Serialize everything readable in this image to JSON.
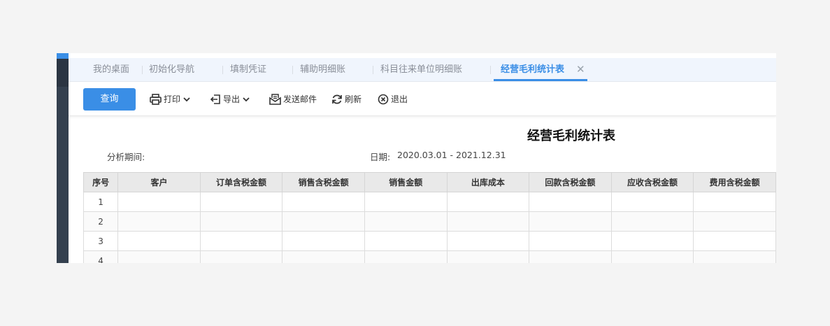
{
  "tabs": [
    {
      "label": "我的桌面",
      "active": false
    },
    {
      "label": "初始化导航",
      "active": false
    },
    {
      "label": "填制凭证",
      "active": false
    },
    {
      "label": "辅助明细账",
      "active": false
    },
    {
      "label": "科目往来单位明细账",
      "active": false
    },
    {
      "label": "经营毛利统计表",
      "active": true
    }
  ],
  "toolbar": {
    "query_label": "查询",
    "print_label": "打印",
    "export_label": "导出",
    "send_mail_label": "发送邮件",
    "refresh_label": "刷新",
    "exit_label": "退出"
  },
  "report": {
    "title": "经营毛利统计表",
    "period_label": "分析期间:",
    "date_label": "日期:",
    "date_value": "2020.03.01 - 2021.12.31"
  },
  "table": {
    "columns": [
      "序号",
      "客户",
      "订单含税金额",
      "销售含税金额",
      "销售金额",
      "出库成本",
      "回款含税金额",
      "应收含税金额",
      "费用含税金额"
    ],
    "rows": [
      [
        "1"
      ],
      [
        "2"
      ],
      [
        "3"
      ],
      [
        "4"
      ]
    ]
  },
  "colors": {
    "accent": "#3a8ee6",
    "sidebar": "#34404f"
  }
}
